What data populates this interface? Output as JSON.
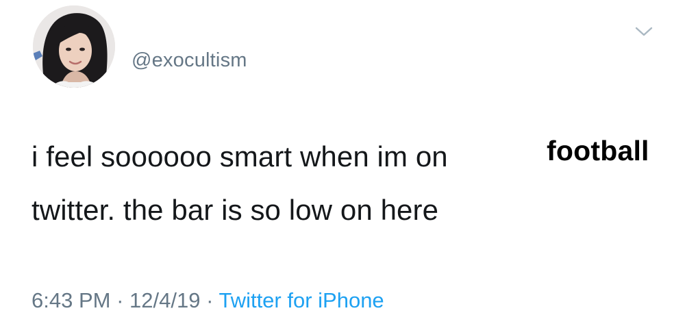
{
  "tweet": {
    "handle": "@exocultism",
    "text_line_1": "i feel soooooo smart when im on",
    "text_line_2": "twitter. the bar is so low on here",
    "overlay_word": "football",
    "time": "6:43 PM",
    "date": "12/4/19",
    "separator": " · ",
    "source": "Twitter for iPhone"
  },
  "icons": {
    "menu": "chevron-down-icon",
    "avatar": "profile-photo"
  },
  "colors": {
    "text": "#14171a",
    "secondary": "#657786",
    "link": "#1da1f2",
    "overlay": "#000000"
  }
}
